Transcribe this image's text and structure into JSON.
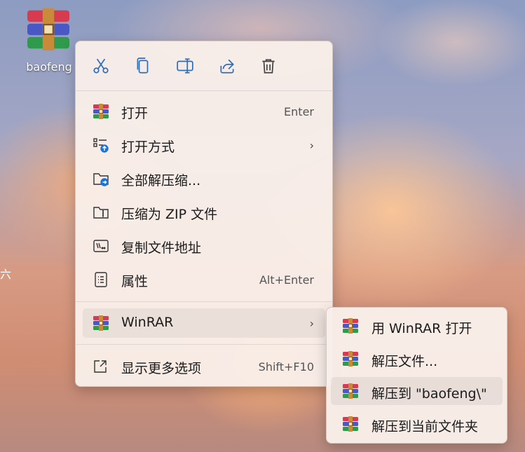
{
  "desktop": {
    "file_icon": {
      "name": "winrar-archive-icon",
      "label": "baofeng"
    },
    "edge_glyph": "六"
  },
  "context_menu": {
    "toolbar": [
      {
        "name": "cut-icon",
        "label": "Cut"
      },
      {
        "name": "copy-icon",
        "label": "Copy"
      },
      {
        "name": "rename-icon",
        "label": "Rename"
      },
      {
        "name": "share-icon",
        "label": "Share"
      },
      {
        "name": "delete-icon",
        "label": "Delete"
      }
    ],
    "items": [
      {
        "label": "打开",
        "shortcut": "Enter",
        "icon": "winrar-icon"
      },
      {
        "label": "打开方式",
        "shortcut": "",
        "icon": "open-with-icon",
        "has_submenu": true
      },
      {
        "label": "全部解压缩...",
        "shortcut": "",
        "icon": "extract-folder-icon"
      },
      {
        "label": "压缩为 ZIP 文件",
        "shortcut": "",
        "icon": "zip-icon"
      },
      {
        "label": "复制文件地址",
        "shortcut": "",
        "icon": "copy-path-icon"
      },
      {
        "label": "属性",
        "shortcut": "Alt+Enter",
        "icon": "properties-icon"
      },
      {
        "label": "WinRAR",
        "shortcut": "",
        "icon": "winrar-icon",
        "has_submenu": true,
        "highlighted": true
      },
      {
        "label": "显示更多选项",
        "shortcut": "Shift+F10",
        "icon": "show-more-icon"
      }
    ],
    "submenu_arrow": "›"
  },
  "winrar_submenu": {
    "items": [
      {
        "label": "用 WinRAR 打开",
        "icon": "winrar-icon"
      },
      {
        "label": "解压文件...",
        "icon": "winrar-icon"
      },
      {
        "label": "解压到 \"baofeng\\\"",
        "icon": "winrar-icon",
        "highlighted": true
      },
      {
        "label": "解压到当前文件夹",
        "icon": "winrar-icon"
      }
    ]
  },
  "colors": {
    "menu_bg": "#f9eee9",
    "accent_blue": "#1a73d9",
    "text": "#1b1b1b"
  }
}
